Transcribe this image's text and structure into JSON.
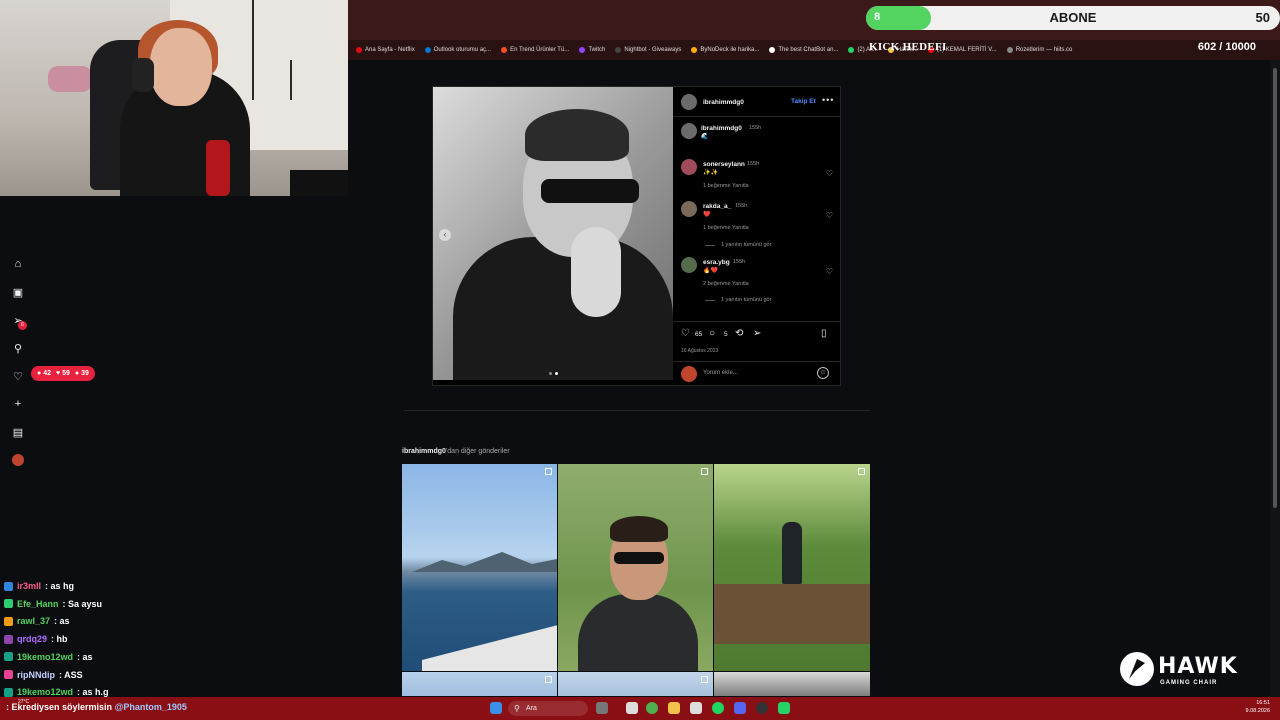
{
  "colors": {
    "accent_red": "#e8213e",
    "kick_green": "#53d35f",
    "link_blue": "#4f8cff",
    "taskbar": "#8a0f14"
  },
  "abone": {
    "left_num": "8",
    "label": "ABONE",
    "right_num": "50",
    "progress": 0.16
  },
  "kick_goal": {
    "label": "KICK HEDEFI",
    "count": "602 / 10000",
    "progress": 0.06
  },
  "bookmarks": [
    "Ana Sayfa - Netflix",
    "Outlook oturumu aç...",
    "En Trend Ürünler Tü...",
    "Twitch",
    "Nightbot - Giveaways",
    "ByNoDeck ile harika...",
    "The best ChatBot an...",
    "(2) Ali...",
    "Harek...",
    "(1) KEMAL FERİTİ V...",
    "Rozetlerim — hiits.co"
  ],
  "post": {
    "username": "ibrahimmdg0",
    "follow_label": "Takip Et",
    "caption_user": "ibrahimmdg0",
    "caption_time": "155h",
    "comments": [
      {
        "user": "sonerseylann",
        "time": "155h",
        "text": "✨✨",
        "meta": "1 beğenme   Yanıtla",
        "replies": ""
      },
      {
        "user": "rakda_a_",
        "time": "155h",
        "text": "❤️",
        "meta": "1 beğenme   Yanıtla",
        "replies": "1 yanıtın tümünü gör"
      },
      {
        "user": "esra.ybg",
        "time": "155h",
        "text": "🔥❤️",
        "meta": "2 beğenme   Yanıtla",
        "replies": "1 yanıtın tümünü gör"
      }
    ],
    "likes": "65",
    "comment_count": "5",
    "date": "16 Ağustos 2023",
    "comment_placeholder": "Yorum ekle..."
  },
  "more_posts": {
    "user": "ibrahimmdg0",
    "suffix": "'dan diğer gönderiler"
  },
  "badge_counts": {
    "comments": "42",
    "likes": "59",
    "follows": "39"
  },
  "chat": [
    {
      "user": "ir3mll",
      "msg": ": as hg",
      "color": "#ff5c8a"
    },
    {
      "user": "Efe_Hann",
      "msg": ": Sa aysu",
      "color": "#53d35f"
    },
    {
      "user": "rawl_37",
      "msg": ": as",
      "color": "#53d35f"
    },
    {
      "user": "qrdq29",
      "msg": ": hb",
      "color": "#b06cff"
    },
    {
      "user": "19kemo12wd",
      "msg": ": as",
      "color": "#53d35f"
    },
    {
      "user": "ripNNdip",
      "msg": ": ASS",
      "color": "#c7d2ff"
    },
    {
      "user": "19kemo12wd",
      "msg": ": as h.g",
      "color": "#53d35f"
    }
  ],
  "taskbar": {
    "message": ": Ekrediysen söylermisin",
    "mention": "@Phantom_1905",
    "search": "Ara",
    "temp": "27°C",
    "time": "16:51",
    "date": "9.08.2026"
  },
  "hawk": {
    "name": "HAWK",
    "sub": "GAMING CHAIR"
  }
}
